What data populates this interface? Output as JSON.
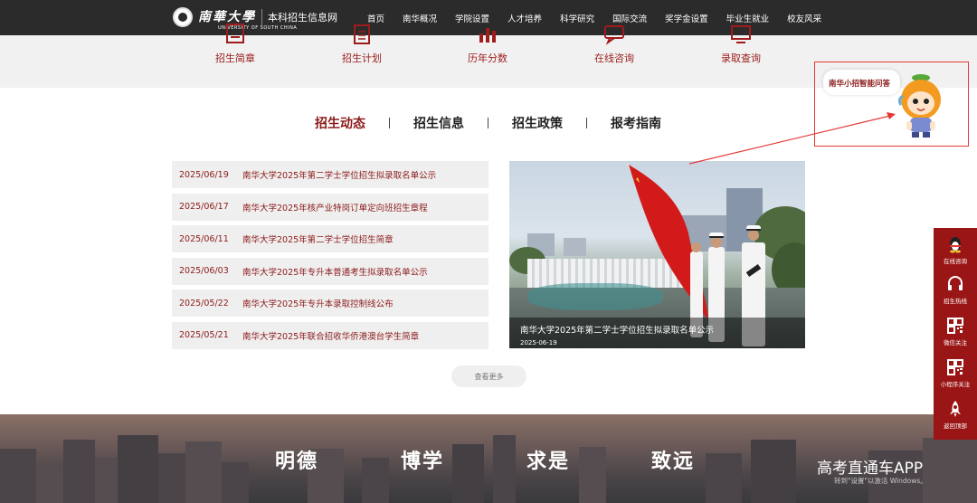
{
  "header": {
    "logo_text": "南華大學",
    "logo_subtext": "UNIVERSITY OF SOUTH CHINA",
    "site_title": "本科招生信息网",
    "nav": [
      "首页",
      "南华概况",
      "学院设置",
      "人才培养",
      "科学研究",
      "国际交流",
      "奖学金设置",
      "毕业生就业",
      "校友风采"
    ]
  },
  "quick_links": [
    {
      "label": "招生简章",
      "icon": "brochure-icon"
    },
    {
      "label": "招生计划",
      "icon": "plan-icon"
    },
    {
      "label": "历年分数",
      "icon": "score-chart-icon"
    },
    {
      "label": "在线咨询",
      "icon": "chat-icon"
    },
    {
      "label": "录取查询",
      "icon": "query-icon"
    }
  ],
  "tabs": {
    "items": [
      "招生动态",
      "招生信息",
      "招生政策",
      "报考指南"
    ],
    "active": "招生动态"
  },
  "news": [
    {
      "date": "2025/06/19",
      "title": "南华大学2025年第二学士学位招生拟录取名单公示"
    },
    {
      "date": "2025/06/17",
      "title": "南华大学2025年核产业特岗订单定向班招生章程"
    },
    {
      "date": "2025/06/11",
      "title": "南华大学2025年第二学士学位招生简章"
    },
    {
      "date": "2025/06/03",
      "title": "南华大学2025年专升本普通考生拟录取名单公示"
    },
    {
      "date": "2025/05/22",
      "title": "南华大学2025年专升本录取控制线公布"
    },
    {
      "date": "2025/05/21",
      "title": "南华大学2025年联合招收华侨港澳台学生简章"
    }
  ],
  "feature": {
    "title": "南华大学2025年第二学士学位招生拟录取名单公示",
    "date": "2025-06-19"
  },
  "more_label": "查看更多",
  "motto": [
    "明德",
    "博学",
    "求是",
    "致远"
  ],
  "assistant_label": "南华小招智能问答",
  "sidebar": [
    {
      "label": "在线咨询",
      "icon": "qq-penguin-icon"
    },
    {
      "label": "招生热线",
      "icon": "headset-icon"
    },
    {
      "label": "微信关注",
      "icon": "qr-code-icon"
    },
    {
      "label": "小程序关注",
      "icon": "qr-code-icon"
    },
    {
      "label": "返回顶部",
      "icon": "rocket-icon"
    }
  ],
  "watermark": {
    "title": "高考直通车APP",
    "subtitle": "转到\"设置\"以激活 Windows。"
  },
  "colors": {
    "brand_red": "#8b1a1a",
    "sidebar_red": "#9a1515",
    "nav_bg": "#2b2b2b",
    "annotation_red": "#e53935"
  }
}
